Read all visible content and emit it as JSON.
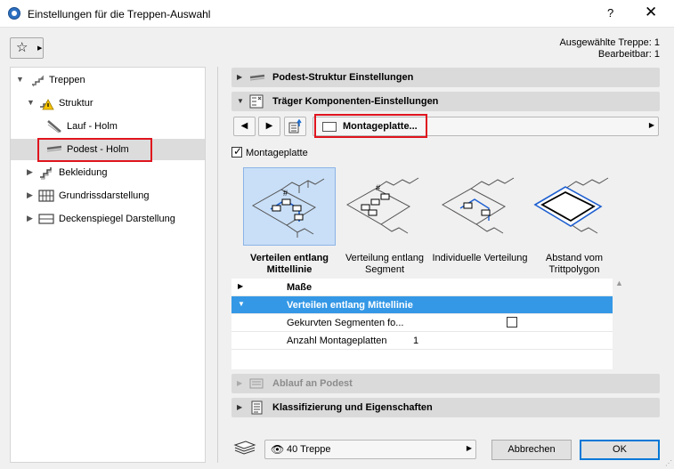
{
  "window": {
    "title": "Einstellungen für die Treppen-Auswahl",
    "help": "?",
    "close": "✕"
  },
  "info": {
    "selected": "Ausgewählte Treppe: 1",
    "editable": "Bearbeitbar: 1"
  },
  "tree": {
    "items": [
      {
        "label": "Treppen",
        "icon": "stair-icon"
      },
      {
        "label": "Struktur",
        "icon": "structure-warning-icon"
      },
      {
        "label": "Lauf - Holm",
        "icon": "flight-stringer-icon"
      },
      {
        "label": "Podest - Holm",
        "icon": "landing-stringer-icon",
        "selected": true
      },
      {
        "label": "Bekleidung",
        "icon": "cladding-icon"
      },
      {
        "label": "Grundrissdarstellung",
        "icon": "floorplan-icon"
      },
      {
        "label": "Deckenspiegel Darstellung",
        "icon": "ceiling-plan-icon"
      }
    ]
  },
  "panels": {
    "podest_struktur": "Podest-Struktur Einstellungen",
    "traeger": "Träger Komponenten-Einstellungen",
    "ablauf": "Ablauf an Podest",
    "klassifizierung": "Klassifizierung und Eigenschaften"
  },
  "component": {
    "selected": "Montageplatte..."
  },
  "montageplatte": {
    "checkbox_label": "Montageplatte",
    "checked": true,
    "options": [
      {
        "label": "Verteilen entlang Mittellinie",
        "selected": true
      },
      {
        "label": "Verteilung entlang Segment"
      },
      {
        "label": "Individuelle Verteilung"
      },
      {
        "label": "Abstand vom Trittpolygon"
      }
    ]
  },
  "grid": {
    "rows": [
      {
        "label": "Maße",
        "bold": true
      },
      {
        "label": "Verteilen entlang Mittellinie",
        "bold": true,
        "selected": true
      },
      {
        "label": "Gekurvten Segmenten fo..."
      },
      {
        "label": "Anzahl Montageplatten",
        "value": "1"
      }
    ]
  },
  "footer": {
    "layer": "40 Treppe",
    "cancel": "Abbrechen",
    "ok": "OK"
  },
  "colors": {
    "accent": "#3498e6",
    "highlight_box": "#e0141e",
    "selected_option": "#c9dff7"
  }
}
